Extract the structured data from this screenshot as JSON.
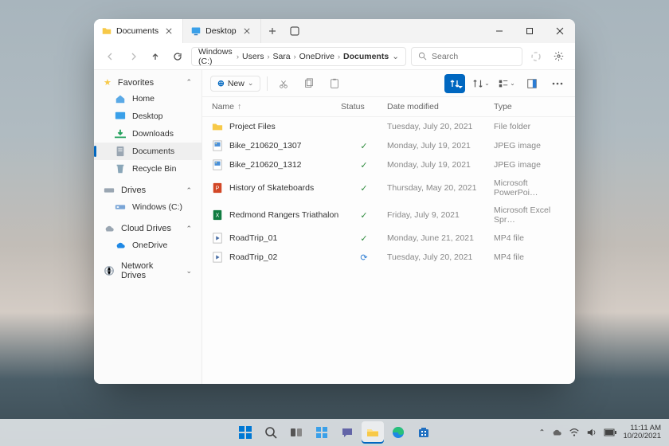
{
  "tabs": [
    {
      "label": "Documents",
      "active": true
    },
    {
      "label": "Desktop",
      "active": false
    }
  ],
  "breadcrumb": [
    "Windows (C:)",
    "Users",
    "Sara",
    "OneDrive",
    "Documents"
  ],
  "search": {
    "placeholder": "Search"
  },
  "sidebar": {
    "favorites_label": "Favorites",
    "favorites": [
      {
        "label": "Home",
        "icon": "home"
      },
      {
        "label": "Desktop",
        "icon": "desktop"
      },
      {
        "label": "Downloads",
        "icon": "downloads"
      },
      {
        "label": "Documents",
        "icon": "documents",
        "selected": true
      },
      {
        "label": "Recycle Bin",
        "icon": "recyclebin"
      }
    ],
    "drives_label": "Drives",
    "drives": [
      {
        "label": "Windows (C:)",
        "icon": "drive"
      }
    ],
    "cloud_label": "Cloud Drives",
    "cloud": [
      {
        "label": "OneDrive",
        "icon": "onedrive"
      }
    ],
    "network_label": "Network Drives"
  },
  "cmdbar": {
    "new_label": "New"
  },
  "columns": {
    "name": "Name",
    "status": "Status",
    "date": "Date modified",
    "type": "Type"
  },
  "files": [
    {
      "name": "Project Files",
      "icon": "folder",
      "status": "",
      "date": "Tuesday, July 20, 2021",
      "type": "File folder"
    },
    {
      "name": "Bike_210620_1307",
      "icon": "jpeg",
      "status": "synced",
      "date": "Monday, July 19, 2021",
      "type": "JPEG image"
    },
    {
      "name": "Bike_210620_1312",
      "icon": "jpeg",
      "status": "synced",
      "date": "Monday, July 19, 2021",
      "type": "JPEG image"
    },
    {
      "name": "History of Skateboards",
      "icon": "ppt",
      "status": "synced",
      "date": "Thursday, May 20, 2021",
      "type": "Microsoft PowerPoi…"
    },
    {
      "name": "Redmond Rangers Triathalon",
      "icon": "xls",
      "status": "synced",
      "date": "Friday, July 9, 2021",
      "type": "Microsoft Excel Spr…"
    },
    {
      "name": "RoadTrip_01",
      "icon": "mp4",
      "status": "synced",
      "date": "Monday, June 21, 2021",
      "type": "MP4 file"
    },
    {
      "name": "RoadTrip_02",
      "icon": "mp4",
      "status": "syncing",
      "date": "Tuesday, July 20, 2021",
      "type": "MP4 file"
    }
  ],
  "systray": {
    "time": "11:11 AM",
    "date": "10/20/2021"
  }
}
